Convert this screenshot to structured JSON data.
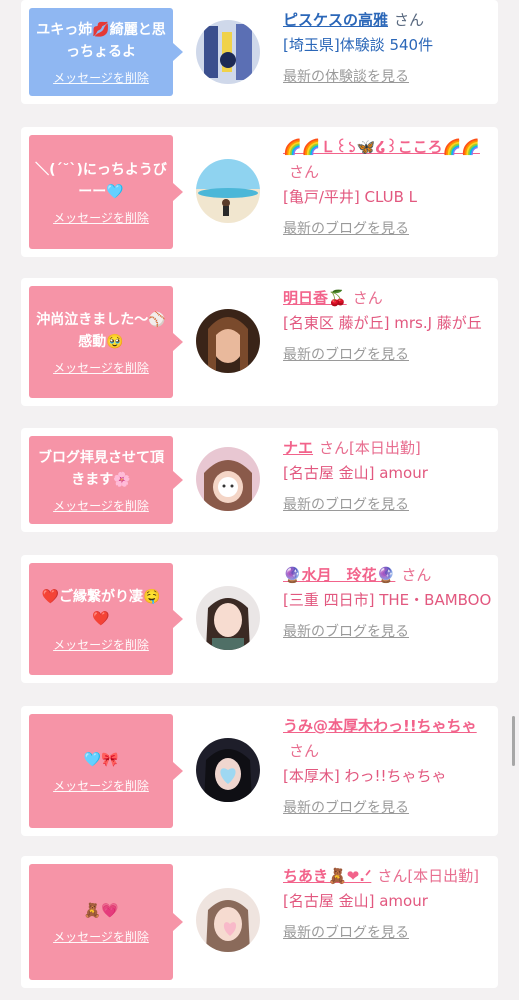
{
  "entries": [
    {
      "message": "ユキっ姉💋綺麗と思っちょるよ",
      "delete_label": "メッセージを削除",
      "name": "ピスケスの高雅",
      "suffix": "さん",
      "sub": "[埼玉県]体験談 540件",
      "link": "最新の体験談を見る"
    },
    {
      "message": "＼(ˊ˘ˋ)にっちようびーー🩵",
      "delete_label": "メッセージを削除",
      "name": "🌈🌈Ｌ꒰১🦋໒꒱こころ🌈🌈",
      "suffix": "さん",
      "sub": "[亀戸/平井] CLUB L",
      "link": "最新のブログを見る"
    },
    {
      "message": "沖尚泣きました〜⚾感動🥹",
      "delete_label": "メッセージを削除",
      "name": "明日香🍒",
      "suffix": "さん",
      "sub": "[名東区 藤が丘] mrs.J 藤が丘",
      "link": "最新のブログを見る"
    },
    {
      "message": "ブログ拝見させて頂きます🌸",
      "delete_label": "メッセージを削除",
      "name": "ナエ",
      "suffix": "さん[本日出勤]",
      "sub": "[名古屋 金山] amour",
      "link": "最新のブログを見る"
    },
    {
      "message": "❤️ご縁繋がり凄🤤❤️",
      "delete_label": "メッセージを削除",
      "name": "🔮水月　玲花🔮",
      "suffix": "さん",
      "sub": "[三重 四日市] THE・BAMBOO",
      "link": "最新のブログを見る"
    },
    {
      "message": "🩵🎀",
      "delete_label": "メッセージを削除",
      "name": "うみ@本厚木わっ!!ちゃちゃ",
      "suffix": "さん",
      "sub": "[本厚木] わっ!!ちゃちゃ",
      "link": "最新のブログを見る"
    },
    {
      "message": "🧸💗",
      "delete_label": "メッセージを削除",
      "name": "ちあき🧸❤︎.ᐟ",
      "suffix": "さん[本日出勤]",
      "sub": "[名古屋 金山] amour",
      "link": "最新のブログを見る"
    }
  ],
  "colors": {
    "bubble_blue": "#8fb7f2",
    "bubble_pink": "#f694a7",
    "accent_pink": "#f2638b",
    "accent_blue": "#2b67b8"
  }
}
